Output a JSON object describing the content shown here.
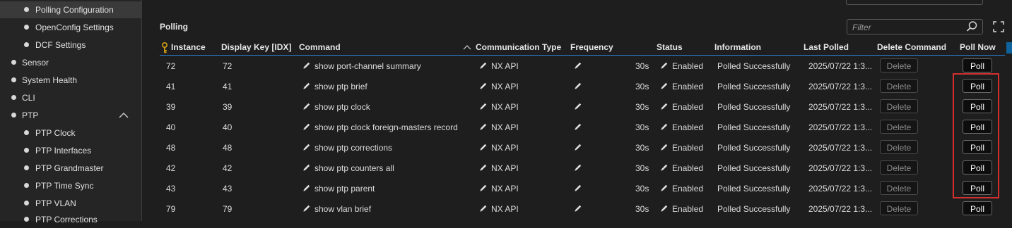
{
  "sidebar": {
    "items": [
      {
        "label": "Polling Configuration",
        "level": 2,
        "selected": true
      },
      {
        "label": "OpenConfig Settings",
        "level": 2
      },
      {
        "label": "DCF Settings",
        "level": 2
      },
      {
        "label": "Sensor",
        "level": 1
      },
      {
        "label": "System Health",
        "level": 1
      },
      {
        "label": "CLI",
        "level": 1
      },
      {
        "label": "PTP",
        "level": 1,
        "expanded": true,
        "chevron": "chevron-up-icon"
      },
      {
        "label": "PTP Clock",
        "level": 2
      },
      {
        "label": "PTP Interfaces",
        "level": 2
      },
      {
        "label": "PTP Grandmaster",
        "level": 2
      },
      {
        "label": "PTP Time Sync",
        "level": 2
      },
      {
        "label": "PTP VLAN",
        "level": 2
      },
      {
        "label": "PTP Corrections",
        "level": 2
      }
    ]
  },
  "main": {
    "title": "Polling",
    "filter": {
      "placeholder": "Filter",
      "value": ""
    },
    "expand_icon": "expand-icon"
  },
  "table": {
    "columns": [
      "Instance",
      "Display Key [IDX]",
      "Command",
      "Communication Type",
      "Frequency",
      "Status",
      "Information",
      "Last Polled",
      "Delete Command",
      "Poll Now"
    ],
    "sort_column": "Command",
    "sort_direction": "ascending",
    "rows": [
      {
        "instance": "72",
        "display_key": "72",
        "command": "show port-channel summary",
        "comm_type": "NX API",
        "frequency": "30s",
        "status": "Enabled",
        "information": "Polled Successfully",
        "last_polled": "2025/07/22 1:3...",
        "delete_label": "Delete",
        "poll_label": "Poll"
      },
      {
        "instance": "41",
        "display_key": "41",
        "command": "show ptp brief",
        "comm_type": "NX API",
        "frequency": "30s",
        "status": "Enabled",
        "information": "Polled Successfully",
        "last_polled": "2025/07/22 1:3...",
        "delete_label": "Delete",
        "poll_label": "Poll"
      },
      {
        "instance": "39",
        "display_key": "39",
        "command": "show ptp clock",
        "comm_type": "NX API",
        "frequency": "30s",
        "status": "Enabled",
        "information": "Polled Successfully",
        "last_polled": "2025/07/22 1:3...",
        "delete_label": "Delete",
        "poll_label": "Poll"
      },
      {
        "instance": "40",
        "display_key": "40",
        "command": "show ptp clock foreign-masters record",
        "comm_type": "NX API",
        "frequency": "30s",
        "status": "Enabled",
        "information": "Polled Successfully",
        "last_polled": "2025/07/22 1:3...",
        "delete_label": "Delete",
        "poll_label": "Poll"
      },
      {
        "instance": "48",
        "display_key": "48",
        "command": "show ptp corrections",
        "comm_type": "NX API",
        "frequency": "30s",
        "status": "Enabled",
        "information": "Polled Successfully",
        "last_polled": "2025/07/22 1:3...",
        "delete_label": "Delete",
        "poll_label": "Poll"
      },
      {
        "instance": "42",
        "display_key": "42",
        "command": "show ptp counters all",
        "comm_type": "NX API",
        "frequency": "30s",
        "status": "Enabled",
        "information": "Polled Successfully",
        "last_polled": "2025/07/22 1:3...",
        "delete_label": "Delete",
        "poll_label": "Poll"
      },
      {
        "instance": "43",
        "display_key": "43",
        "command": "show ptp parent",
        "comm_type": "NX API",
        "frequency": "30s",
        "status": "Enabled",
        "information": "Polled Successfully",
        "last_polled": "2025/07/22 1:3...",
        "delete_label": "Delete",
        "poll_label": "Poll"
      },
      {
        "instance": "79",
        "display_key": "79",
        "command": "show vlan brief",
        "comm_type": "NX API",
        "frequency": "30s",
        "status": "Enabled",
        "information": "Polled Successfully",
        "last_polled": "2025/07/22 1:3...",
        "delete_label": "Delete",
        "poll_label": "Poll"
      }
    ]
  },
  "colors": {
    "background": "#1e1e1e",
    "sidebar": "#252526",
    "accent_line": "#2a7fd4",
    "key_icon": "#d4a017",
    "highlight_box": "#d32f2f"
  },
  "icons": {
    "key": "key-icon",
    "edit": "pencil-icon",
    "search": "search-icon",
    "sort": "sort-up-icon"
  }
}
